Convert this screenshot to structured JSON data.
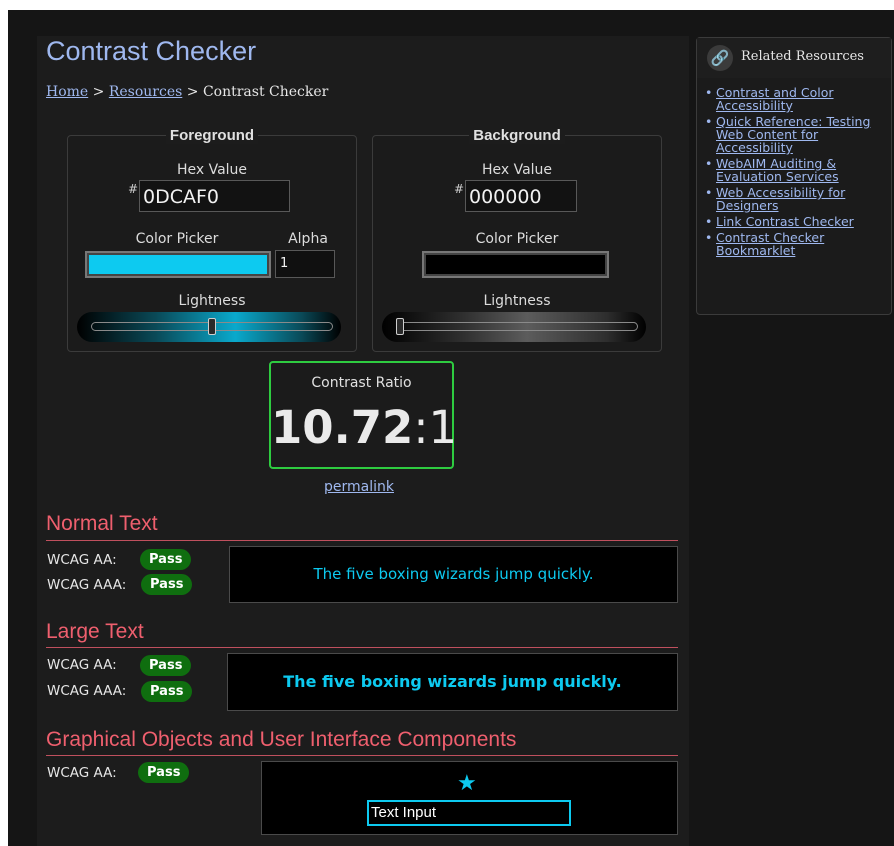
{
  "page": {
    "title": "Contrast Checker",
    "breadcrumb": {
      "home": "Home",
      "sep1": ">",
      "resources": "Resources",
      "sep2": ">",
      "current": "Contrast Checker"
    }
  },
  "foreground": {
    "legend": "Foreground",
    "hex_label": "Hex Value",
    "hash": "#",
    "hex_value": "0DCAF0",
    "picker_label": "Color Picker",
    "alpha_label": "Alpha",
    "alpha_value": "1",
    "lightness_label": "Lightness",
    "color": "#0dcaf0",
    "lightness_fraction": 0.5
  },
  "background": {
    "legend": "Background",
    "hex_label": "Hex Value",
    "hash": "#",
    "hex_value": "000000",
    "picker_label": "Color Picker",
    "lightness_label": "Lightness",
    "color": "#000000",
    "lightness_fraction": 0.0
  },
  "contrast": {
    "label": "Contrast Ratio",
    "ratio": "10.72",
    "suffix": ":1",
    "permalink": "permalink",
    "border_color": "#2ecc40"
  },
  "normal_text": {
    "title": "Normal Text",
    "aa_label": "WCAG AA:",
    "aa_result": "Pass",
    "aaa_label": "WCAG AAA:",
    "aaa_result": "Pass",
    "sample": "The five boxing wizards jump quickly."
  },
  "large_text": {
    "title": "Large Text",
    "aa_label": "WCAG AA:",
    "aa_result": "Pass",
    "aaa_label": "WCAG AAA:",
    "aaa_result": "Pass",
    "sample": "The five boxing wizards jump quickly."
  },
  "graphical": {
    "title": "Graphical Objects and User Interface Components",
    "aa_label": "WCAG AA:",
    "aa_result": "Pass",
    "star_icon": "star-icon",
    "text_input": "Text Input"
  },
  "related": {
    "title": "Related Resources",
    "icon": "link-icon",
    "links": [
      "Contrast and Color Accessibility",
      "Quick Reference: Testing Web Content for Accessibility",
      "WebAIM Auditing & Evaluation Services",
      "Web Accessibility for Designers",
      "Link Contrast Checker",
      "Contrast Checker Bookmarklet"
    ]
  },
  "colors": {
    "accent": "#9fb8ef",
    "section_title": "#ef5f6e",
    "pass_badge": "#0f6e0f"
  }
}
